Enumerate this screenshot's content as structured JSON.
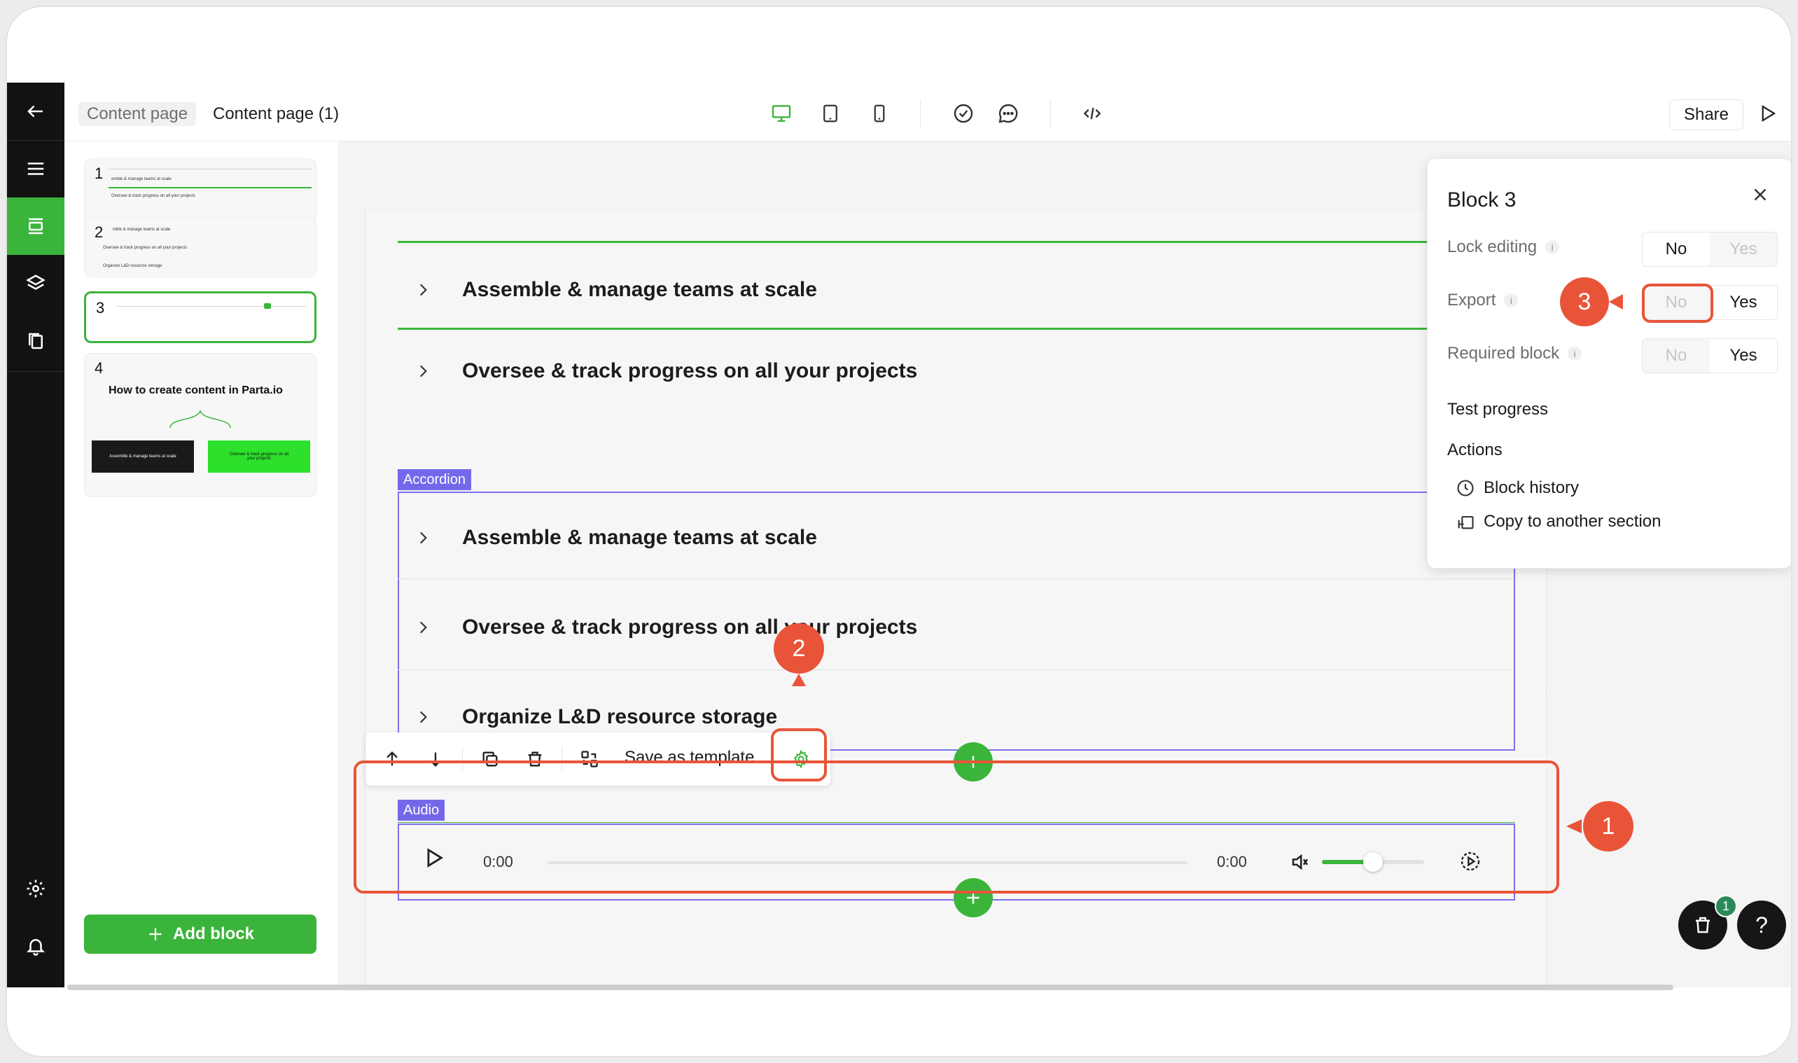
{
  "breadcrumb": {
    "parent": "Content page",
    "current": "Content page (1)"
  },
  "topbar": {
    "share_label": "Share"
  },
  "pages": [
    {
      "num": "1",
      "lines": [
        "emble & manage teams at scale",
        "Oversee & track progress on all your projects"
      ]
    },
    {
      "num": "2",
      "lines": [
        "mble & manage teams at scale",
        "Oversee & track progress on all your projects",
        "Organize L&D resource storage"
      ]
    },
    {
      "num": "3",
      "lines": []
    },
    {
      "num": "4",
      "title": "How to create content in Parta.io",
      "card_left": "Assemble & manage teams at scale",
      "card_right": "Oversee & track progress on all your projects"
    }
  ],
  "add_block_label": "Add block",
  "canvas": {
    "top_rows": [
      "Assemble & manage teams at scale",
      "Oversee & track progress on all your projects"
    ],
    "accordion_tag": "Accordion",
    "accordion_rows": [
      "Assemble & manage teams at scale",
      "Oversee & track progress on all your projects",
      "Organize L&D resource storage"
    ],
    "toolbar_save_label": "Save as template",
    "audio_tag": "Audio",
    "audio_time_start": "0:00",
    "audio_time_end": "0:00",
    "audio_progress": 0,
    "audio_volume": 0.5
  },
  "callouts": [
    "1",
    "2",
    "3"
  ],
  "panel": {
    "title": "Block 3",
    "lock_editing_label": "Lock editing",
    "export_label": "Export",
    "required_block_label": "Required block",
    "no_label": "No",
    "yes_label": "Yes",
    "info_glyph": "i",
    "test_progress_label": "Test progress",
    "actions_label": "Actions",
    "block_history_label": "Block history",
    "copy_section_label": "Copy to another section"
  },
  "fab": {
    "cart_count": "1",
    "help_label": "?"
  },
  "colors": {
    "accent_green": "#3bb43b",
    "accent_purple": "#7468ea",
    "callout_red": "#e95439",
    "rail_dark": "#121212"
  }
}
